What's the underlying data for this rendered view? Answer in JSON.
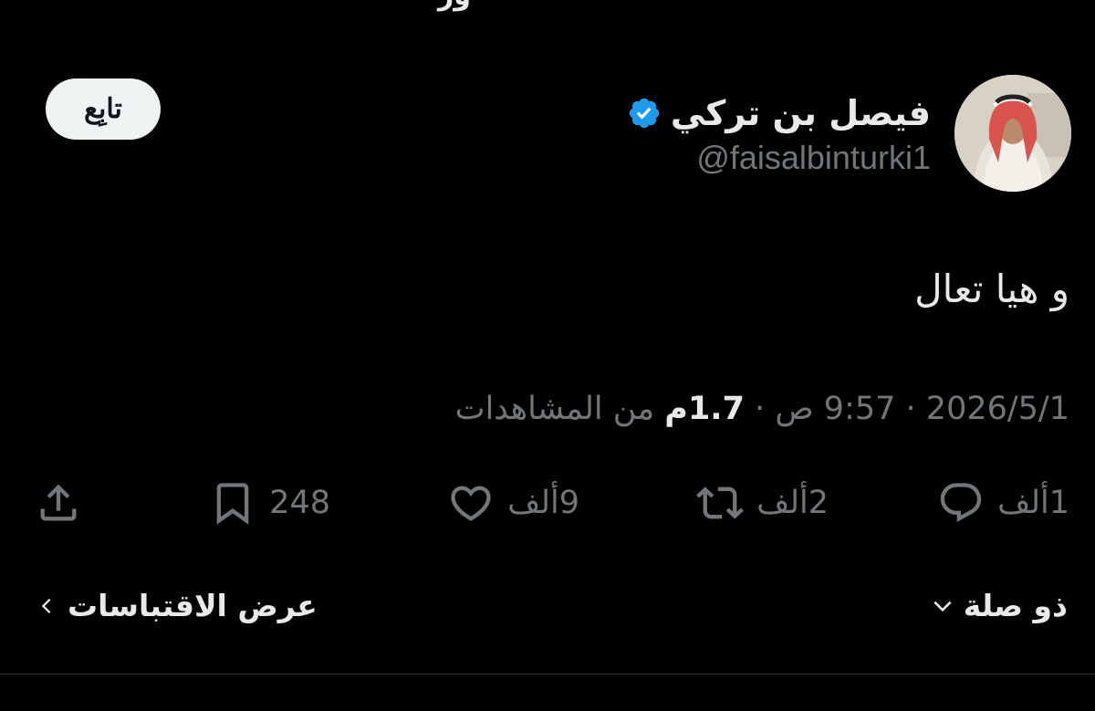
{
  "header": {
    "cut_text": "ور"
  },
  "author": {
    "display_name": "فيصل بن تركي",
    "handle": "@faisalbinturki1",
    "verified_color": "#1d9bf0"
  },
  "follow_label": "تابِع",
  "tweet": {
    "text": "و هيا تعال"
  },
  "meta": {
    "date": "2026/5/1",
    "sep1": " · ",
    "time": "9:57 ص",
    "sep2": " · ",
    "views_count": "1.7م",
    "views_label": " من المشاهدات"
  },
  "actions": {
    "replies": "1ألف",
    "reposts": "2ألف",
    "likes": "9ألف",
    "bookmarks": "248"
  },
  "footer": {
    "related_label": "ذو صلة",
    "quotes_label": "عرض الاقتباسات"
  },
  "colors": {
    "background": "#000000",
    "text": "#e7e9ea",
    "muted": "#71767b",
    "accent": "#1d9bf0"
  }
}
